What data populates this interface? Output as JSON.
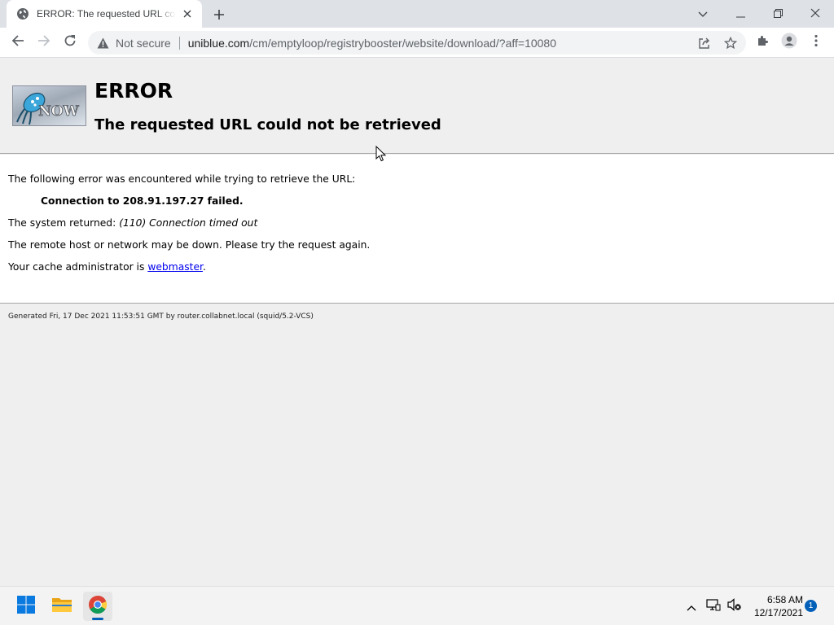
{
  "browser": {
    "tab": {
      "title": "ERROR: The requested URL could not be retrieved",
      "favicon": "globe-icon"
    },
    "new_tab_symbol": "+",
    "address": {
      "security_label": "Not secure",
      "url_host": "uniblue.com",
      "url_path": "/cm/emptyloop/registrybooster/website/download/?aff=10080"
    },
    "window_controls": [
      "chevron-down-icon",
      "minimize-icon",
      "restore-icon",
      "close-icon"
    ],
    "toolbar_icons": [
      "back-icon",
      "forward-icon",
      "reload-icon",
      "share-icon",
      "star-icon",
      "extensions-icon",
      "profile-icon",
      "menu-icon"
    ]
  },
  "page": {
    "logo_text": "NOW",
    "title": "ERROR",
    "subtitle": "The requested URL could not be retrieved",
    "intro": "The following error was encountered while trying to retrieve the URL:",
    "error_detail": "Connection to 208.91.197.27 failed.",
    "system_returned_label": "The system returned:",
    "system_returned_value": "(110) Connection timed out",
    "remote_host_msg": "The remote host or network may be down. Please try the request again.",
    "cache_admin_prefix": "Your cache administrator is",
    "cache_admin_link": "webmaster",
    "cache_admin_suffix": ".",
    "footer": "Generated Fri, 17 Dec 2021 11:53:51 GMT by router.collabnet.local (squid/5.2-VCS)"
  },
  "taskbar": {
    "apps": [
      "windows-start-icon",
      "file-explorer-icon",
      "chrome-icon"
    ],
    "tray_icons": [
      "chevron-up-icon",
      "network-icon",
      "volume-muted-icon"
    ],
    "time": "6:58 AM",
    "date": "12/17/2021",
    "notification_count": "1"
  },
  "colors": {
    "link": "#0000ee",
    "tab_strip": "#dee1e6",
    "taskbar_accent": "#005fb8"
  }
}
